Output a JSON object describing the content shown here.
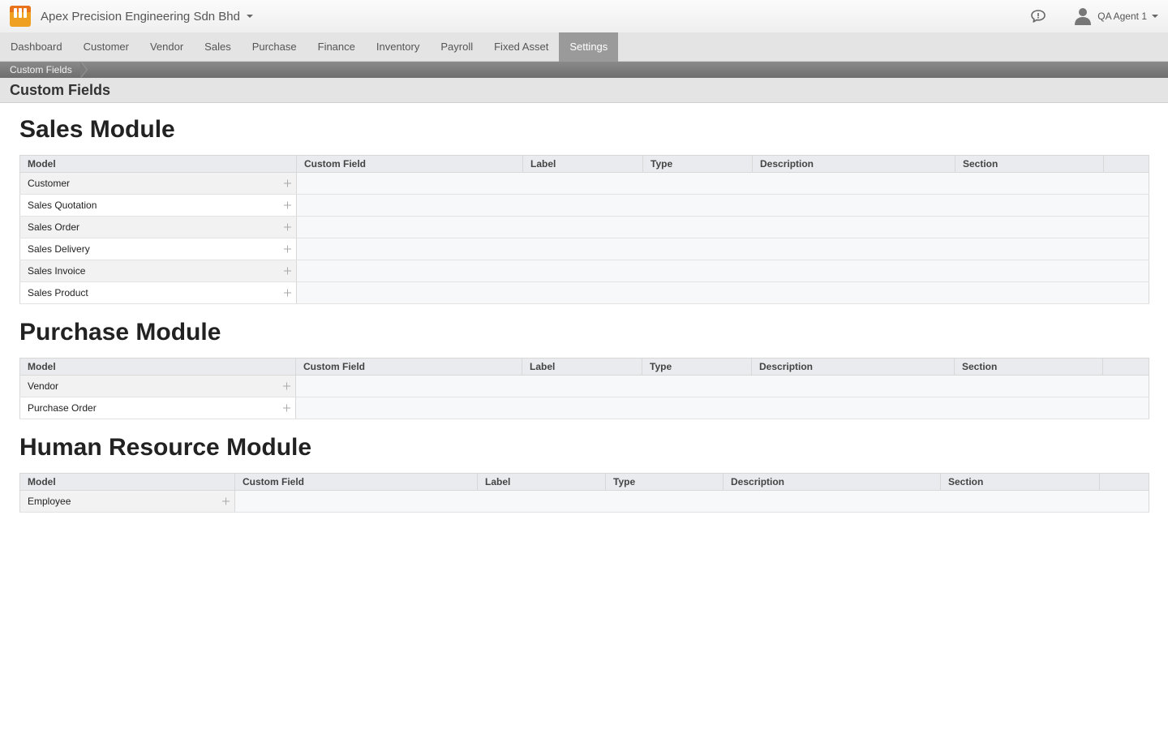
{
  "header": {
    "company": "Apex Precision Engineering Sdn Bhd",
    "user": "QA Agent 1"
  },
  "nav": {
    "items": [
      "Dashboard",
      "Customer",
      "Vendor",
      "Sales",
      "Purchase",
      "Finance",
      "Inventory",
      "Payroll",
      "Fixed Asset",
      "Settings"
    ],
    "active": "Settings"
  },
  "breadcrumb": {
    "current": "Custom Fields"
  },
  "page": {
    "title": "Custom Fields"
  },
  "columns": {
    "model": "Model",
    "custom_field": "Custom Field",
    "label": "Label",
    "type": "Type",
    "description": "Description",
    "section": "Section"
  },
  "modules": [
    {
      "title": "Sales Module",
      "models": [
        "Customer",
        "Sales Quotation",
        "Sales Order",
        "Sales Delivery",
        "Sales Invoice",
        "Sales Product"
      ]
    },
    {
      "title": "Purchase Module",
      "models": [
        "Vendor",
        "Purchase Order"
      ]
    },
    {
      "title": "Human Resource Module",
      "models": [
        "Employee"
      ]
    }
  ]
}
